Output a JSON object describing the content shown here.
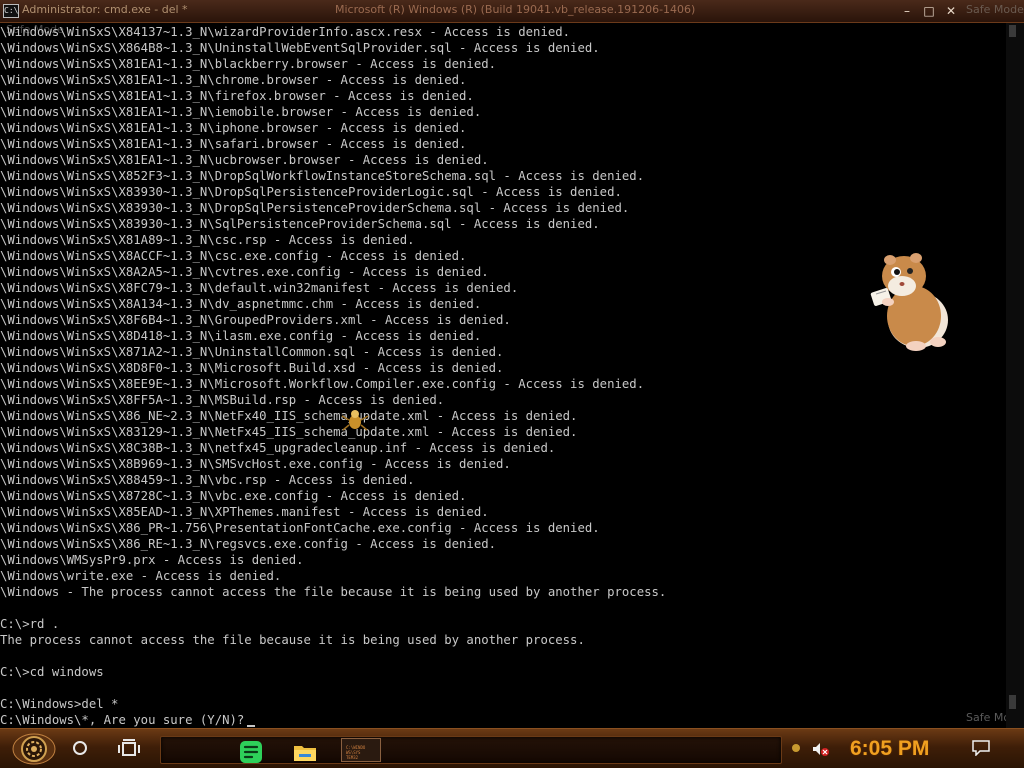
{
  "window": {
    "icon_text": "C:\\",
    "title": "Administrator: cmd.exe - del  *",
    "build_title": "Microsoft (R) Windows (R) (Build 19041.vb_release.191206-1406)",
    "controls": {
      "minimize": "–",
      "maximize": "□",
      "close": "✕"
    },
    "watermark_top": "Safe Mode",
    "watermark_left": "Safe Mode",
    "watermark_bottom": "Safe Mode"
  },
  "console": {
    "lines": [
      "\\Windows\\WinSxS\\X84137~1.3_N\\wizardProviderInfo.ascx.resx - Access is denied.",
      "\\Windows\\WinSxS\\X864B8~1.3_N\\UninstallWebEventSqlProvider.sql - Access is denied.",
      "\\Windows\\WinSxS\\X81EA1~1.3_N\\blackberry.browser - Access is denied.",
      "\\Windows\\WinSxS\\X81EA1~1.3_N\\chrome.browser - Access is denied.",
      "\\Windows\\WinSxS\\X81EA1~1.3_N\\firefox.browser - Access is denied.",
      "\\Windows\\WinSxS\\X81EA1~1.3_N\\iemobile.browser - Access is denied.",
      "\\Windows\\WinSxS\\X81EA1~1.3_N\\iphone.browser - Access is denied.",
      "\\Windows\\WinSxS\\X81EA1~1.3_N\\safari.browser - Access is denied.",
      "\\Windows\\WinSxS\\X81EA1~1.3_N\\ucbrowser.browser - Access is denied.",
      "\\Windows\\WinSxS\\X852F3~1.3_N\\DropSqlWorkflowInstanceStoreSchema.sql - Access is denied.",
      "\\Windows\\WinSxS\\X83930~1.3_N\\DropSqlPersistenceProviderLogic.sql - Access is denied.",
      "\\Windows\\WinSxS\\X83930~1.3_N\\DropSqlPersistenceProviderSchema.sql - Access is denied.",
      "\\Windows\\WinSxS\\X83930~1.3_N\\SqlPersistenceProviderSchema.sql - Access is denied.",
      "\\Windows\\WinSxS\\X81A89~1.3_N\\csc.rsp - Access is denied.",
      "\\Windows\\WinSxS\\X8ACCF~1.3_N\\csc.exe.config - Access is denied.",
      "\\Windows\\WinSxS\\X8A2A5~1.3_N\\cvtres.exe.config - Access is denied.",
      "\\Windows\\WinSxS\\X8FC79~1.3_N\\default.win32manifest - Access is denied.",
      "\\Windows\\WinSxS\\X8A134~1.3_N\\dv_aspnetmmc.chm - Access is denied.",
      "\\Windows\\WinSxS\\X8F6B4~1.3_N\\GroupedProviders.xml - Access is denied.",
      "\\Windows\\WinSxS\\X8D418~1.3_N\\ilasm.exe.config - Access is denied.",
      "\\Windows\\WinSxS\\X871A2~1.3_N\\UninstallCommon.sql - Access is denied.",
      "\\Windows\\WinSxS\\X8D8F0~1.3_N\\Microsoft.Build.xsd - Access is denied.",
      "\\Windows\\WinSxS\\X8EE9E~1.3_N\\Microsoft.Workflow.Compiler.exe.config - Access is denied.",
      "\\Windows\\WinSxS\\X8FF5A~1.3_N\\MSBuild.rsp - Access is denied.",
      "\\Windows\\WinSxS\\X86_NE~2.3_N\\NetFx40_IIS_schema_update.xml - Access is denied.",
      "\\Windows\\WinSxS\\X83129~1.3_N\\NetFx45_IIS_schema_update.xml - Access is denied.",
      "\\Windows\\WinSxS\\X8C38B~1.3_N\\netfx45_upgradecleanup.inf - Access is denied.",
      "\\Windows\\WinSxS\\X8B969~1.3_N\\SMSvcHost.exe.config - Access is denied.",
      "\\Windows\\WinSxS\\X88459~1.3_N\\vbc.rsp - Access is denied.",
      "\\Windows\\WinSxS\\X8728C~1.3_N\\vbc.exe.config - Access is denied.",
      "\\Windows\\WinSxS\\X85EAD~1.3_N\\XPThemes.manifest - Access is denied.",
      "\\Windows\\WinSxS\\X86_PR~1.756\\PresentationFontCache.exe.config - Access is denied.",
      "\\Windows\\WinSxS\\X86_RE~1.3_N\\regsvcs.exe.config - Access is denied.",
      "\\Windows\\WMSysPr9.prx - Access is denied.",
      "\\Windows\\write.exe - Access is denied.",
      "\\Windows - The process cannot access the file because it is being used by another process.",
      "",
      "C:\\>rd .",
      "The process cannot access the file because it is being used by another process.",
      "",
      "C:\\>cd windows",
      "",
      "C:\\Windows>del *",
      "C:\\Windows\\*, Are you sure (Y/N)?"
    ]
  },
  "taskbar": {
    "clock": "6:05 PM",
    "console_thumb_lines": [
      "C:\\WINDO",
      "WS\\SYS",
      "TEM32"
    ]
  },
  "colors": {
    "console_text": "#c8c8c8",
    "console_bg": "#000000",
    "clock": "#f0a020",
    "taskbar": "#3e1e08"
  },
  "icons": {
    "start": "steampunk-gear-start-icon",
    "search": "search-circle-icon",
    "task_view": "task-view-icon",
    "app_green": "green-chat-app-icon",
    "app_folder": "file-explorer-folder-icon",
    "app_console": "command-prompt-icon",
    "tray_gear": "tray-gear-icon",
    "volume": "volume-muted-icon",
    "notifications": "notification-center-icon",
    "pet": "hamster-desktop-pet-icon",
    "bug": "bug-sprite-icon"
  }
}
